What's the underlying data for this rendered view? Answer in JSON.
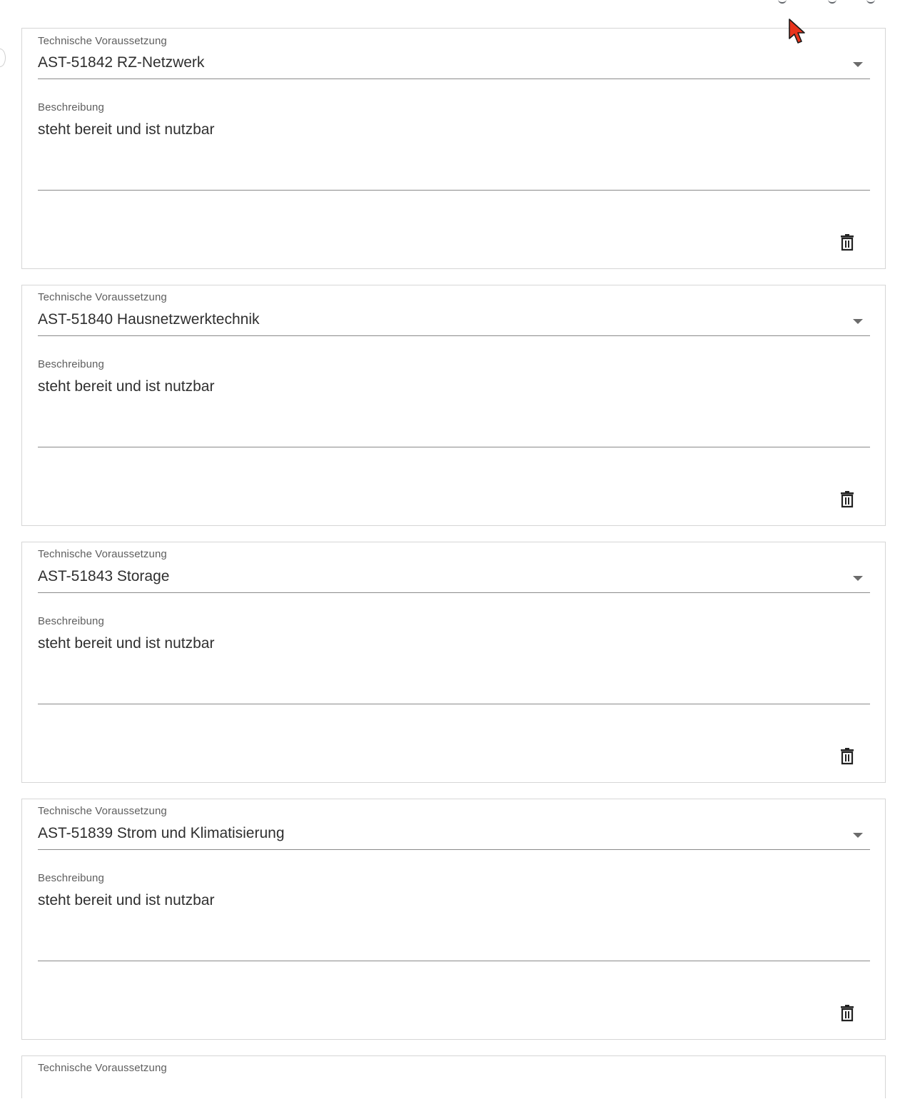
{
  "items": [
    {
      "requirement_label": "Technische Voraussetzung",
      "requirement_value": "AST-51842 RZ-Netzwerk",
      "description_label": "Beschreibung",
      "description_value": "steht bereit und ist nutzbar"
    },
    {
      "requirement_label": "Technische Voraussetzung",
      "requirement_value": "AST-51840 Hausnetzwerktechnik",
      "description_label": "Beschreibung",
      "description_value": "steht bereit und ist nutzbar"
    },
    {
      "requirement_label": "Technische Voraussetzung",
      "requirement_value": "AST-51843 Storage",
      "description_label": "Beschreibung",
      "description_value": "steht bereit und ist nutzbar"
    },
    {
      "requirement_label": "Technische Voraussetzung",
      "requirement_value": "AST-51839 Strom und Klimatisierung",
      "description_label": "Beschreibung",
      "description_value": "steht bereit und ist nutzbar"
    },
    {
      "requirement_label": "Technische Voraussetzung"
    }
  ],
  "icons": {
    "delete": "trash-icon",
    "dropdown": "caret-down-icon",
    "cursor": "mouse-pointer-icon"
  },
  "colors": {
    "cursor_fill": "#e8331c",
    "card_border": "#d6d6d6",
    "underline": "#8a8a8a"
  }
}
